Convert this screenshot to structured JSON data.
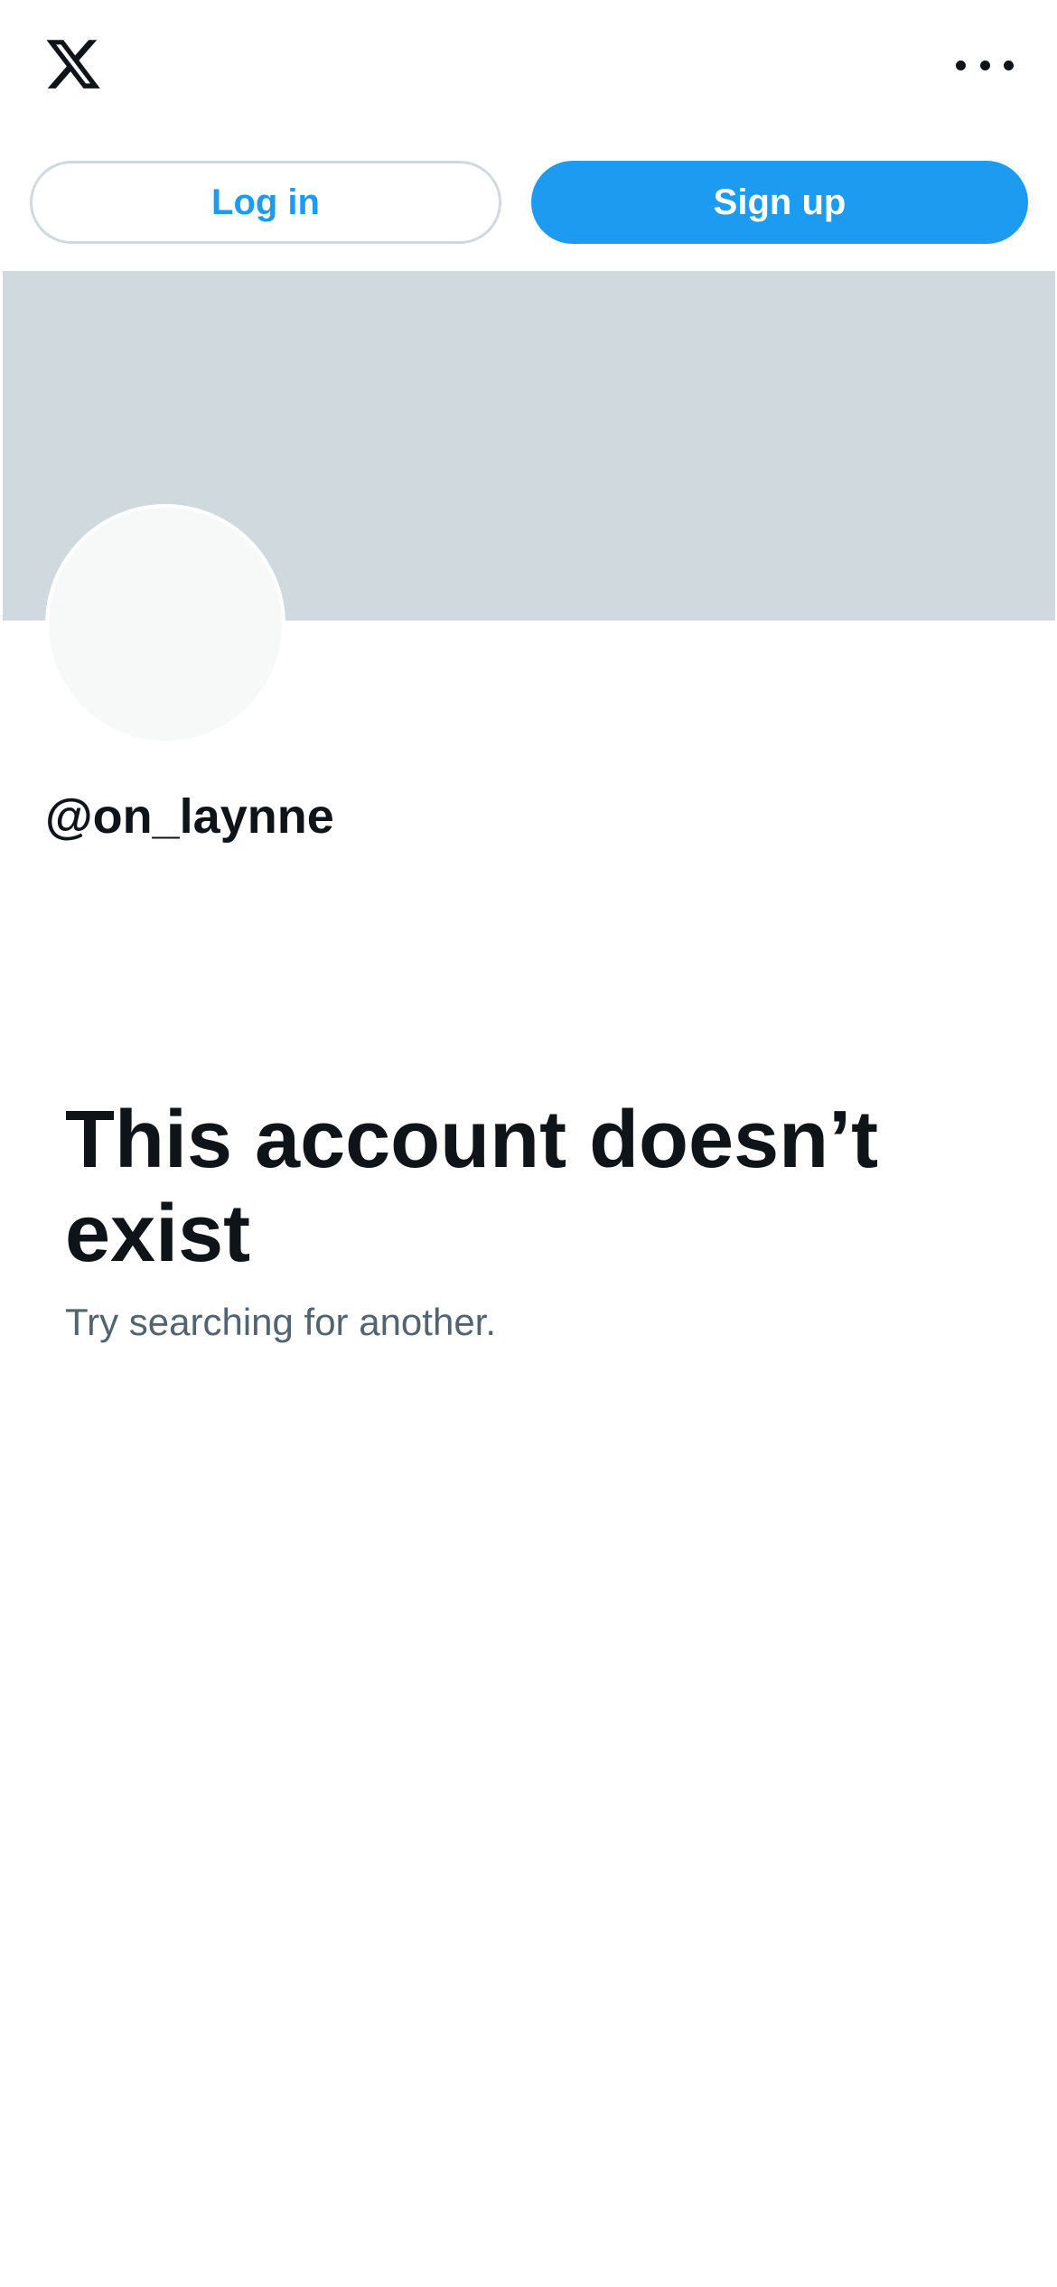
{
  "header": {
    "logo_icon": "x-logo-icon",
    "more_icon": "more-horizontal-icon"
  },
  "auth": {
    "login_label": "Log in",
    "signup_label": "Sign up"
  },
  "profile": {
    "handle": "@on_laynne"
  },
  "empty_state": {
    "title": "This account doesn’t exist",
    "subtitle": "Try searching for another."
  },
  "colors": {
    "accent": "#1d9bf0",
    "banner": "#cfd9de",
    "text_primary": "#0f1419",
    "text_secondary": "#536471",
    "avatar_placeholder": "#f7f9f9"
  }
}
